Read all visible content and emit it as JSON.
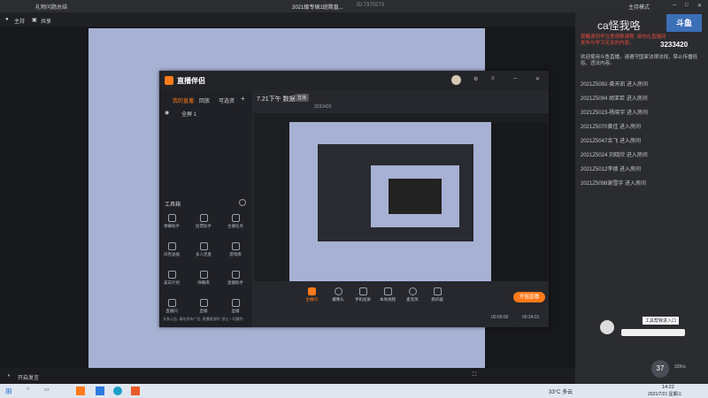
{
  "top": {
    "left_title": "礼物问题总结",
    "center_title": "2021级专硕1班简直...",
    "center_sub": "ID:7370273",
    "right_label": "主持模式"
  },
  "subbar": {
    "item1": "主持",
    "item2": "共享"
  },
  "bottombar": {
    "mic_label": "开启发言"
  },
  "inner": {
    "logo": "直播伴侣",
    "tabs": [
      "我的直播",
      "回放",
      "可选资"
    ],
    "source_label": "全屏 1",
    "time_label": "7.21下午 数据",
    "badge": "直播",
    "stream_info": "3233420",
    "tools_title": "工具箱",
    "tools": [
      "弹幕助手",
      "投票助手",
      "主播任务",
      "问卷送福",
      "多人连麦",
      "游戏库",
      "美白计划",
      "弹幕库",
      "直播助手",
      "直播间",
      "直播",
      "直播"
    ],
    "controls": [
      {
        "label": "主播间",
        "active": true
      },
      {
        "label": "摄像头"
      },
      {
        "label": "手机投屏"
      },
      {
        "label": "本地视频"
      },
      {
        "label": "麦克风"
      },
      {
        "label": "扬声器"
      }
    ],
    "start_button": "开始直播",
    "status_left": "头条公告: 请勿发布广告, 直播推流时, 禁止一切操作",
    "time1": "00:00:00",
    "time2": "00:24:01"
  },
  "right": {
    "title": "ca怪我咯",
    "system_msg": "提醒请同学注意观察课程, 请勿在直播间发布与学习无关的内容。",
    "room_id": "3233420",
    "welcome": "欢迎使用斗鱼直播，请遵守国家法律法规，禁止传播低俗、违法内容。",
    "messages": [
      "2021Z5092-黄天凯 进入房间",
      "2021Z5094 胡亚若 进入房间",
      "2021Z5023-杨晓宇 进入房间",
      "2021Z5070黄佳 进入房间",
      "2021Z5047余飞 进入房间",
      "2021Z5024 刘晓欣 进入房间",
      "2021Z5012李德 进入房间",
      "2021Z5098谢雪宇 进入房间"
    ],
    "enter_label": "工具帮我进入口",
    "viewer_count": "37",
    "stats": "32K/s"
  },
  "taskbar": {
    "weather": "33°C 多云",
    "time": "14:22",
    "date": "2021/7/21 星期三"
  },
  "colors": {
    "accent": "#ff7a1a",
    "canvas": "#a7b1d4"
  }
}
